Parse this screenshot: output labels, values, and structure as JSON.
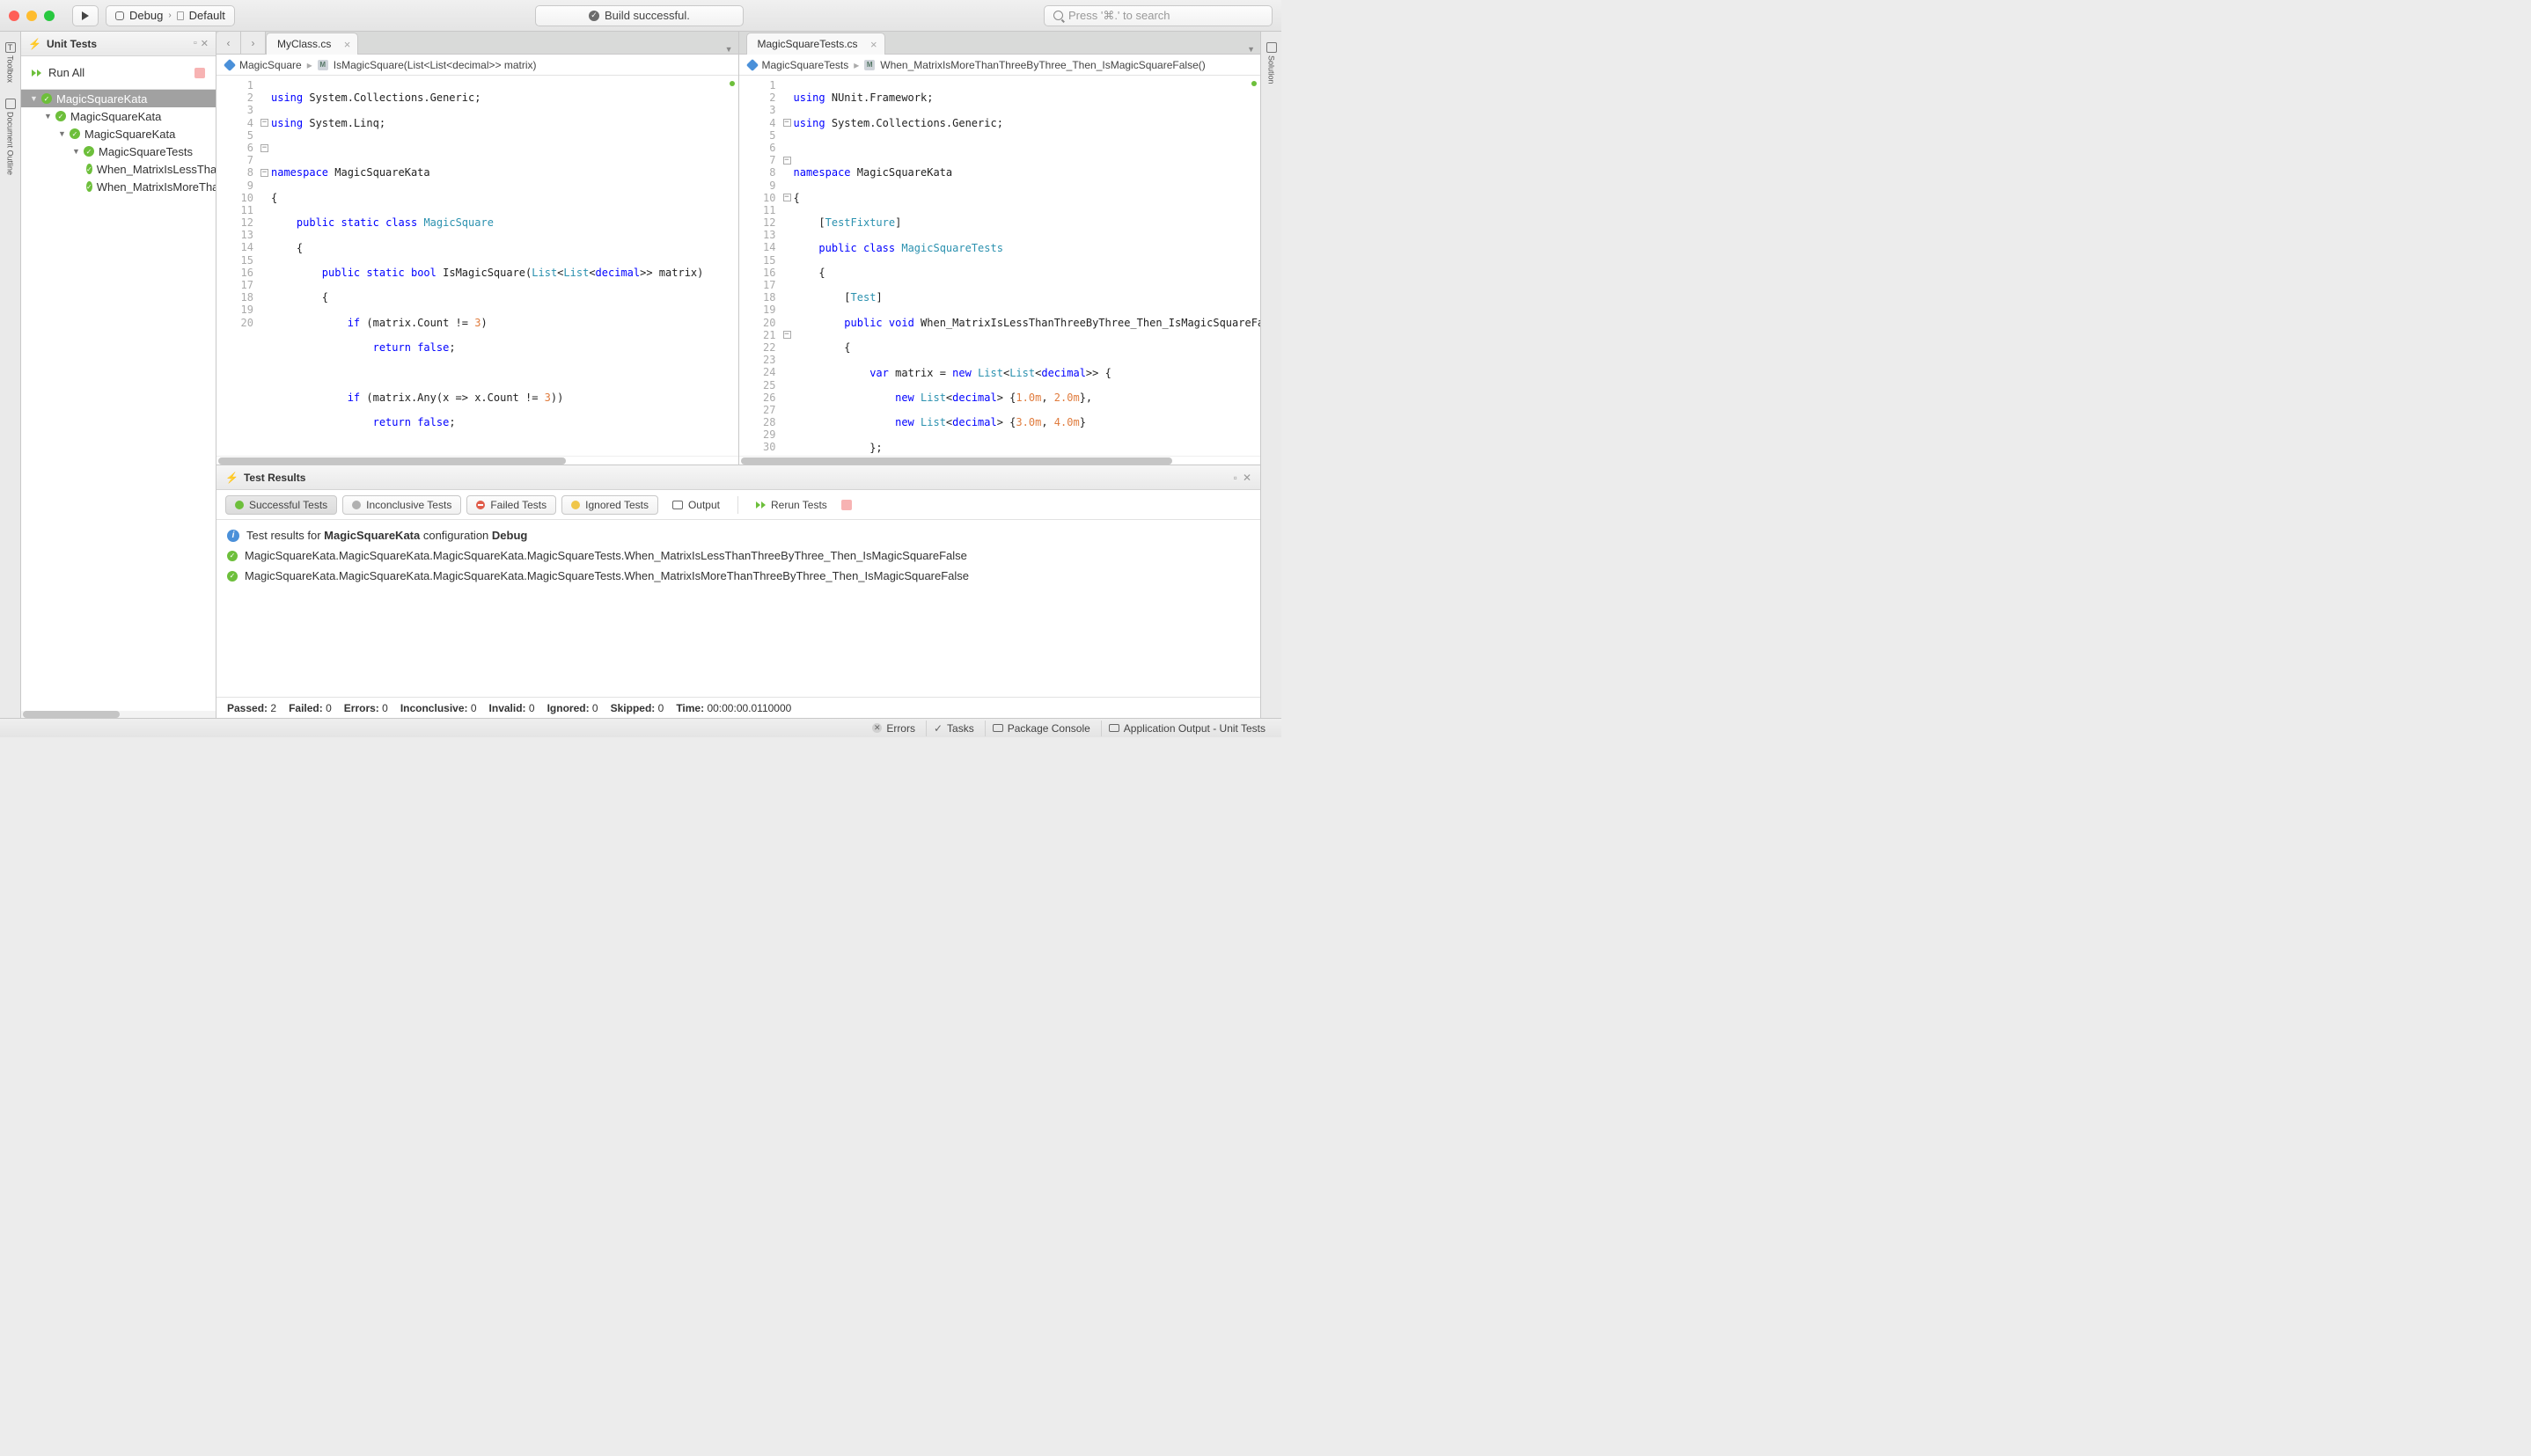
{
  "toolbar": {
    "debug": "Debug",
    "default": "Default",
    "status": "Build successful.",
    "search_placeholder": "Press '⌘.' to search"
  },
  "left_rail": {
    "toolbox": "Toolbox",
    "doc_outline": "Document Outline"
  },
  "right_rail": {
    "solution": "Solution"
  },
  "tests_panel": {
    "title": "Unit Tests",
    "run_all": "Run All",
    "tree": [
      "MagicSquareKata",
      "MagicSquareKata",
      "MagicSquareKata",
      "MagicSquareTests",
      "When_MatrixIsLessThanThreeByThree_Then_IsMagicSquareFalse",
      "When_MatrixIsMoreThanThreeByThree_Then_IsMagicSquareFalse"
    ]
  },
  "editor_left": {
    "tab": "MyClass.cs",
    "crumb_ns": "MagicSquare",
    "crumb_method": "IsMagicSquare(List<List<decimal>> matrix)"
  },
  "editor_right": {
    "tab": "MagicSquareTests.cs",
    "crumb_ns": "MagicSquareTests",
    "crumb_method": "When_MatrixIsMoreThanThreeByThree_Then_IsMagicSquareFalse()"
  },
  "results": {
    "title": "Test Results",
    "chips": {
      "successful": "Successful Tests",
      "inconclusive": "Inconclusive Tests",
      "failed": "Failed Tests",
      "ignored": "Ignored Tests",
      "output": "Output",
      "rerun": "Rerun Tests"
    },
    "info_prefix": "Test results for ",
    "info_proj": "MagicSquareKata",
    "info_mid": " configuration ",
    "info_cfg": "Debug",
    "line1": "MagicSquareKata.MagicSquareKata.MagicSquareKata.MagicSquareTests.When_MatrixIsLessThanThreeByThree_Then_IsMagicSquareFalse",
    "line2": "MagicSquareKata.MagicSquareKata.MagicSquareKata.MagicSquareTests.When_MatrixIsMoreThanThreeByThree_Then_IsMagicSquareFalse",
    "summary_labels": {
      "passed": "Passed:",
      "failed": "Failed:",
      "errors": "Errors:",
      "inconclusive": "Inconclusive:",
      "invalid": "Invalid:",
      "ignored": "Ignored:",
      "skipped": "Skipped:",
      "time": "Time:"
    },
    "summary_values": {
      "passed": "2",
      "failed": "0",
      "errors": "0",
      "inconclusive": "0",
      "invalid": "0",
      "ignored": "0",
      "skipped": "0",
      "time": "00:00:00.0110000"
    }
  },
  "statusbar": {
    "errors": "Errors",
    "tasks": "Tasks",
    "pkg": "Package Console",
    "app": "Application Output - Unit Tests"
  }
}
